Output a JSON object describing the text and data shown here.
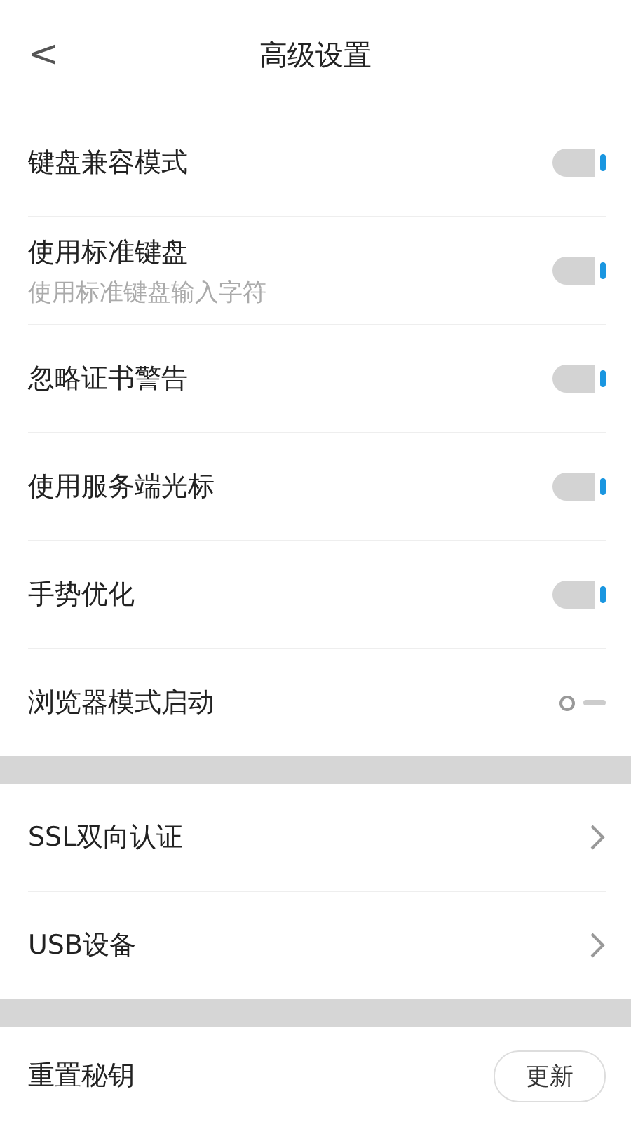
{
  "header": {
    "back": "<",
    "title": "高级设置"
  },
  "sections": [
    {
      "rows": [
        {
          "kind": "toggle",
          "label": "键盘兼容模式",
          "on": true
        },
        {
          "kind": "toggle",
          "label": "使用标准键盘",
          "sublabel": "使用标准键盘输入字符",
          "on": true
        },
        {
          "kind": "toggle",
          "label": "忽略证书警告",
          "on": true
        },
        {
          "kind": "toggle",
          "label": "使用服务端光标",
          "on": true
        },
        {
          "kind": "toggle",
          "label": "手势优化",
          "on": true
        },
        {
          "kind": "toggle",
          "label": "浏览器模式启动",
          "on": false
        }
      ]
    },
    {
      "rows": [
        {
          "kind": "link",
          "label": "SSL双向认证"
        },
        {
          "kind": "link",
          "label": "USB设备"
        }
      ]
    },
    {
      "rows": [
        {
          "kind": "action",
          "label": "重置秘钥",
          "button": "更新"
        }
      ]
    }
  ]
}
